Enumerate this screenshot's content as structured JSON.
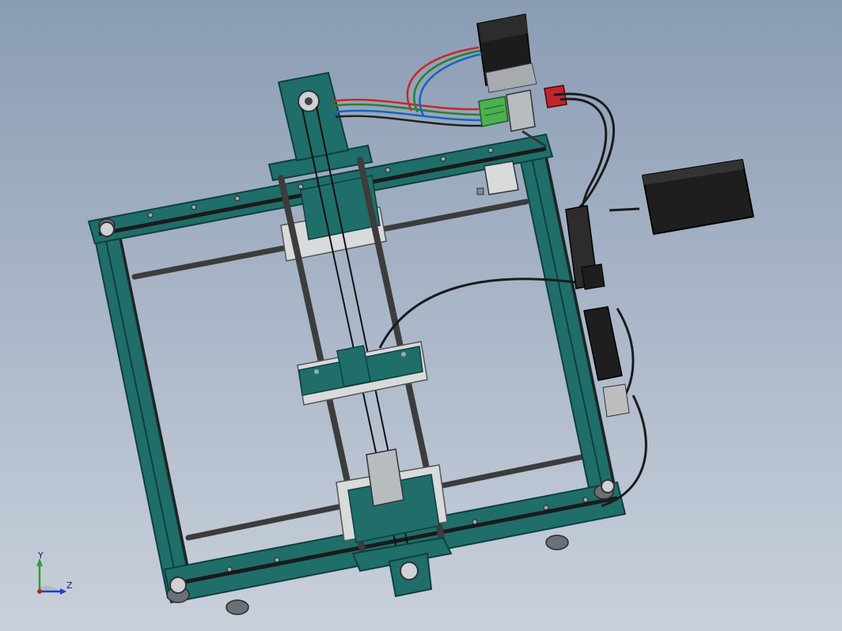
{
  "viewport": {
    "background_top": "#8a9cb4",
    "background_bottom": "#c9d0db"
  },
  "model": {
    "frame_color": "#1f6e6a",
    "frame_dark": "#0f3f3d",
    "rod_color": "#3c3c3c",
    "belt_color": "#1a1a1a",
    "motor_color": "#1c1c1c",
    "power_supply_color": "#1e1e1e",
    "connector_color": "#4caf50",
    "switch_color": "#c0272d",
    "wire_colors": [
      "#c62828",
      "#2e7d32",
      "#1565c0",
      "#212121"
    ]
  },
  "triad": {
    "y_label": "Y",
    "z_label": "Z",
    "y_color": "#2e9e2e",
    "z_color": "#1a3ec9",
    "x_color": "#c81e1e"
  }
}
